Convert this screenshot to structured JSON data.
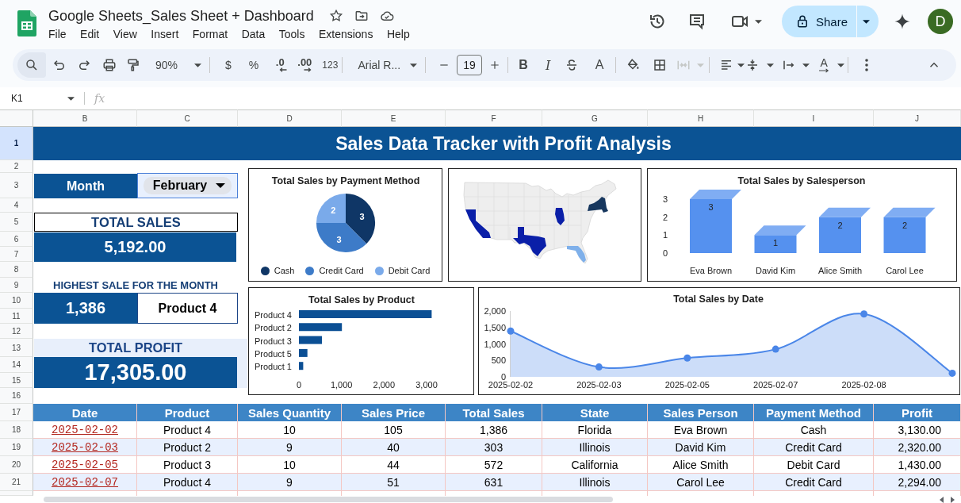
{
  "app_bar": {
    "document_title": "Google Sheets_Sales Sheet + Dashboard",
    "menu": [
      "File",
      "Edit",
      "View",
      "Insert",
      "Format",
      "Data",
      "Tools",
      "Extensions",
      "Help"
    ],
    "share_label": "Share",
    "avatar_initial": "D"
  },
  "toolbar": {
    "zoom": "90%",
    "currency": "$",
    "percent": "%",
    "decrease_decimals": ".0",
    "increase_decimals": ".00",
    "number_format": "123",
    "font": "Arial R...",
    "font_size": "19",
    "bold": "B",
    "italic": "I",
    "text_color": "A",
    "merge_cells": {
      "disabled": true
    },
    "text_rotation": "A"
  },
  "formula_bar": {
    "cell_reference": "K1",
    "function_label": "fx"
  },
  "sheet": {
    "columns": [
      "B",
      "C",
      "D",
      "E",
      "F",
      "G",
      "H",
      "I",
      "J"
    ],
    "rows": [
      {
        "label": "1",
        "selected": true
      },
      {
        "label": "2",
        "selected": false
      },
      {
        "label": "3",
        "selected": false
      },
      {
        "label": "4",
        "selected": false
      },
      {
        "label": "5",
        "selected": false
      },
      {
        "label": "6",
        "selected": false
      },
      {
        "label": "7",
        "selected": false
      },
      {
        "label": "8",
        "selected": false
      },
      {
        "label": "9",
        "selected": false
      },
      {
        "label": "10",
        "selected": false
      },
      {
        "label": "11",
        "selected": false
      },
      {
        "label": "12",
        "selected": false
      },
      {
        "label": "13",
        "selected": false
      },
      {
        "label": "14",
        "selected": false
      },
      {
        "label": "15",
        "selected": false
      },
      {
        "label": "16",
        "selected": false
      },
      {
        "label": "17",
        "selected": false
      },
      {
        "label": "18",
        "selected": false
      },
      {
        "label": "19",
        "selected": false
      },
      {
        "label": "20",
        "selected": false
      },
      {
        "label": "21",
        "selected": false
      }
    ]
  },
  "dashboard": {
    "title": "Sales Data Tracker with Profit Analysis",
    "month_label": "Month",
    "month_value": "February",
    "total_sales_label": "TOTAL SALES",
    "total_sales": "5,192.00",
    "highest_sale_label": "HIGHEST SALE FOR THE MONTH",
    "highest_sale": "1,386",
    "highest_sale_product": "Product 4",
    "total_profit_label": "TOTAL PROFIT",
    "total_profit": "17,305.00"
  },
  "payment_method_chart": {
    "chart_data": [
      {
        "type": "pie",
        "title": "Total Sales by Payment Method",
        "categories": [
          "Cash",
          "Credit Card",
          "Debit Card"
        ],
        "values": [
          3,
          3,
          2
        ],
        "colors": [
          "#0f3666",
          "#3d7bc8",
          "#7aaaea"
        ],
        "data_labels": true,
        "legend": "bottom"
      }
    ]
  },
  "salesperson_chart": {
    "chart_data": [
      {
        "type": "bar",
        "title": "Total Sales by Salesperson",
        "categories": [
          "Eva Brown",
          "David Kim",
          "Alice Smith",
          "Carol Lee"
        ],
        "values": [
          3,
          1,
          2,
          2
        ],
        "color": "#5591ef",
        "ylim": [
          0,
          3
        ],
        "yticks": [
          0,
          1,
          2,
          3
        ],
        "data_labels": true
      }
    ]
  },
  "product_chart": {
    "chart_data": [
      {
        "type": "bar",
        "orientation": "horizontal",
        "title": "Total Sales by Product",
        "categories": [
          "Product 4",
          "Product 2",
          "Product 3",
          "Product 5",
          "Product 1"
        ],
        "values": [
          3120,
          1010,
          540,
          200,
          100
        ],
        "color": "#0b4f94",
        "xlim": [
          0,
          3200
        ],
        "xticks": [
          0,
          {
            "value": 1000,
            "label": "1,000"
          },
          {
            "value": 2000,
            "label": "2,000"
          },
          {
            "value": 3000,
            "label": "3,000"
          }
        ]
      }
    ]
  },
  "date_chart": {
    "chart_data": [
      {
        "type": "area",
        "title": "Total Sales by Date",
        "categories": [
          "2025-02-02",
          "2025-02-03",
          "2025-02-05",
          "2025-02-07",
          "2025-02-08",
          null
        ],
        "values": [
          1390,
          300,
          570,
          840,
          1910,
          110
        ],
        "color": "#4a86e8",
        "marker": "circle",
        "ylim": [
          0,
          2000
        ],
        "yticks": [
          0,
          500,
          {
            "value": 1000,
            "label": "1,000"
          },
          {
            "value": 1500,
            "label": "1,500"
          },
          {
            "value": 2000,
            "label": "2,000"
          }
        ]
      }
    ]
  },
  "table": {
    "columns": [
      "Date",
      "Product",
      "Sales Quantity",
      "Sales Price",
      "Total Sales",
      "State",
      "Sales Person",
      "Payment Method",
      "Profit"
    ],
    "rows": [
      [
        "2025-02-02",
        "Product 4",
        "10",
        "105",
        "1,386",
        "Florida",
        "Eva Brown",
        "Cash",
        "3,130.00"
      ],
      [
        "2025-02-03",
        "Product 2",
        "9",
        "40",
        "303",
        "Illinois",
        "David Kim",
        "Credit Card",
        "2,320.00"
      ],
      [
        "2025-02-05",
        "Product 3",
        "10",
        "44",
        "572",
        "California",
        "Alice Smith",
        "Debit Card",
        "1,430.00"
      ],
      [
        "2025-02-07",
        "Product 4",
        "9",
        "51",
        "631",
        "Illinois",
        "Carol Lee",
        "Credit Card",
        "2,294.00"
      ]
    ]
  }
}
